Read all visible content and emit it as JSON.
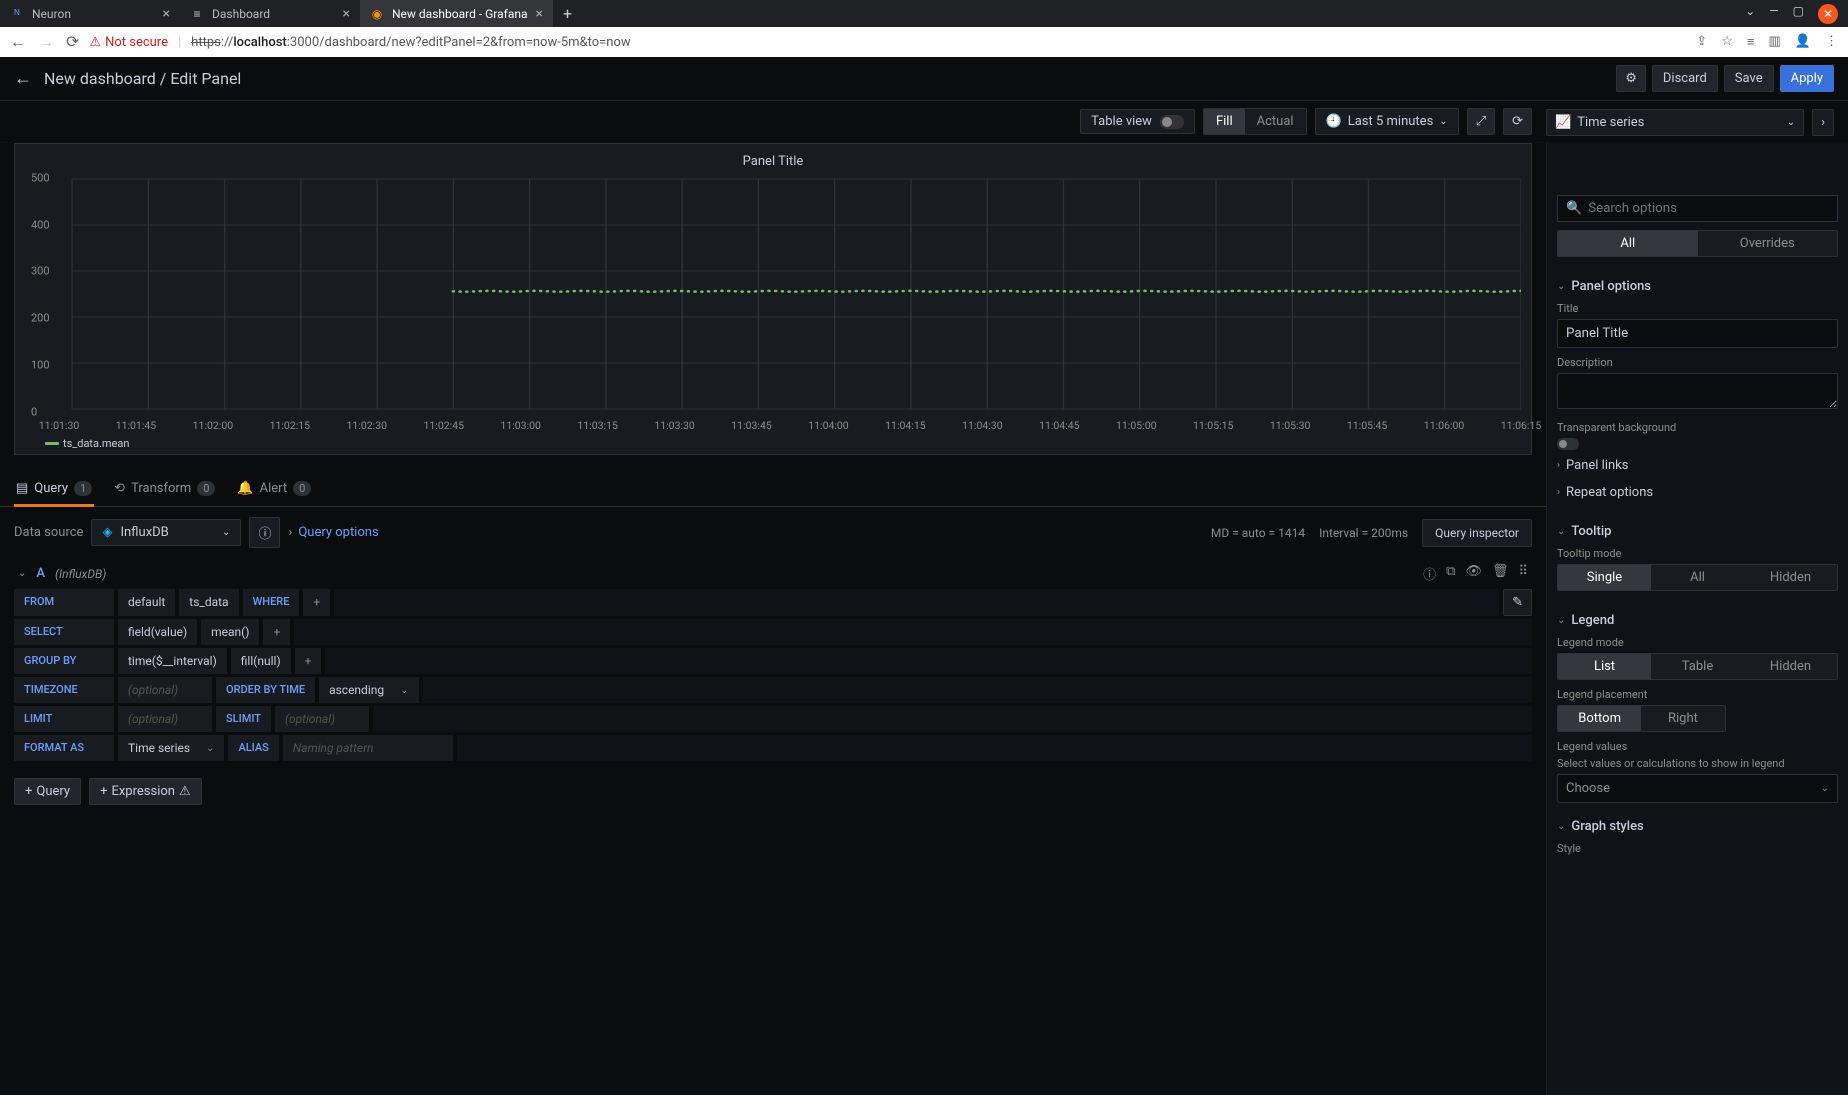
{
  "browser": {
    "tabs": [
      {
        "label": "Neuron",
        "active": false
      },
      {
        "label": "Dashboard",
        "active": false
      },
      {
        "label": "New dashboard - Grafana",
        "active": true
      }
    ],
    "not_secure": "Not secure",
    "url_proto": "https",
    "url_sep": "://",
    "url_host": "localhost",
    "url_rest": ":3000/dashboard/new?editPanel=2&from=now-5m&to=now"
  },
  "header": {
    "crumb": "New dashboard / Edit Panel",
    "discard": "Discard",
    "save": "Save",
    "apply": "Apply"
  },
  "toolbar": {
    "table_view": "Table view",
    "fill": "Fill",
    "actual": "Actual",
    "time_range": "Last 5 minutes",
    "viz_type": "Time series"
  },
  "panel": {
    "title": "Panel Title",
    "legend": "ts_data.mean"
  },
  "chart_data": {
    "type": "scatter",
    "title": "Panel Title",
    "ylabel": "",
    "ylim": [
      0,
      500
    ],
    "y_ticks": [
      0,
      100,
      200,
      300,
      400,
      500
    ],
    "x_labels": [
      "11:01:30",
      "11:01:45",
      "11:02:00",
      "11:02:15",
      "11:02:30",
      "11:02:45",
      "11:03:00",
      "11:03:15",
      "11:03:30",
      "11:03:45",
      "11:04:00",
      "11:04:15",
      "11:04:30",
      "11:04:45",
      "11:05:00",
      "11:05:15",
      "11:05:30",
      "11:05:45",
      "11:06:00",
      "11:06:15"
    ],
    "series": [
      {
        "name": "ts_data.mean",
        "color": "#73bf69",
        "y": 256,
        "x_start": "11:02:45",
        "x_end": "11:06:20"
      }
    ]
  },
  "tabs": {
    "query": "Query",
    "query_n": "1",
    "transform": "Transform",
    "transform_n": "0",
    "alert": "Alert",
    "alert_n": "0"
  },
  "ds_row": {
    "label": "Data source",
    "ds": "InfluxDB",
    "qopts": "Query options",
    "meta_md": "MD = auto = 1414",
    "meta_int": "Interval = 200ms",
    "inspector": "Query inspector"
  },
  "query": {
    "name": "A",
    "type": "(InfluxDB)",
    "from": "FROM",
    "from_v1": "default",
    "from_v2": "ts_data",
    "where": "WHERE",
    "select": "SELECT",
    "select_v1": "field(value)",
    "select_v2": "mean()",
    "groupby": "GROUP BY",
    "gb_v1": "time($__interval)",
    "gb_v2": "fill(null)",
    "tz": "TIMEZONE",
    "opt": "(optional)",
    "orderby": "ORDER BY TIME",
    "order": "ascending",
    "limit": "LIMIT",
    "slimit": "SLIMIT",
    "formatas": "FORMAT AS",
    "fmt": "Time series",
    "alias": "ALIAS",
    "alias_ph": "Naming pattern"
  },
  "bottom": {
    "query": "Query",
    "expr": "Expression"
  },
  "right": {
    "search_ph": "Search options",
    "all": "All",
    "overrides": "Overrides",
    "panel_options": "Panel options",
    "title": "Title",
    "title_v": "Panel Title",
    "desc": "Description",
    "transparent": "Transparent background",
    "panel_links": "Panel links",
    "repeat": "Repeat options",
    "tooltip": "Tooltip",
    "tooltip_mode": "Tooltip mode",
    "single": "Single",
    "tt_all": "All",
    "hidden": "Hidden",
    "legend": "Legend",
    "legend_mode": "Legend mode",
    "list": "List",
    "table": "Table",
    "legend_place": "Legend placement",
    "bottom": "Bottom",
    "right": "Right",
    "legend_values": "Legend values",
    "legend_hint": "Select values or calculations to show in legend",
    "choose": "Choose",
    "graph_styles": "Graph styles",
    "style": "Style"
  }
}
